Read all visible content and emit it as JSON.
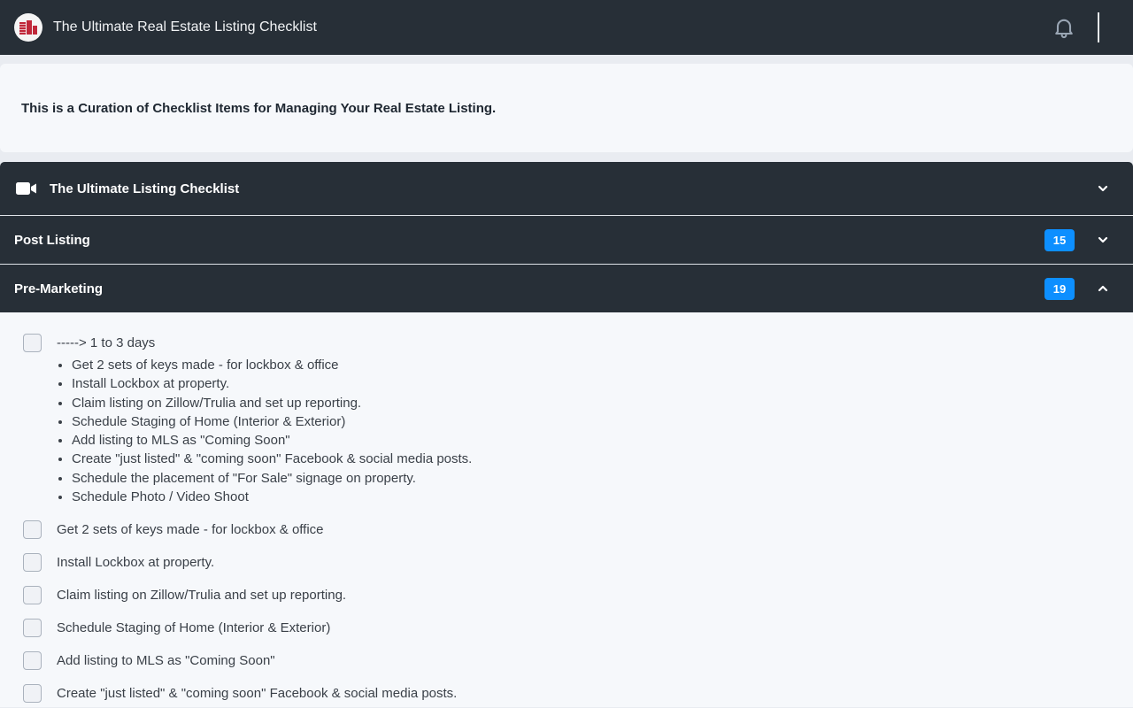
{
  "app": {
    "title": "The Ultimate Real Estate Listing Checklist",
    "logo_icon": "building-logo-icon",
    "notification_icon": "bell-icon"
  },
  "intro": {
    "text": "This is a Curation of Checklist Items for Managing Your Real Estate Listing."
  },
  "sections": [
    {
      "title": "The Ultimate Listing Checklist",
      "icon": "video-camera-icon",
      "badge": null,
      "expanded": false
    },
    {
      "title": "Post Listing",
      "badge": "15",
      "expanded": false
    },
    {
      "title": "Pre-Marketing",
      "badge": "19",
      "expanded": true
    }
  ],
  "premarketing": {
    "grouped_item": {
      "label": "-----> 1 to 3 days",
      "checked": false,
      "subitems": [
        "Get 2 sets of keys made - for lockbox & office",
        "Install Lockbox at property.",
        "Claim listing on Zillow/Trulia and set up reporting.",
        "Schedule Staging of Home (Interior & Exterior)",
        "Add listing to MLS as \"Coming Soon\"",
        "Create \"just listed\" & \"coming soon\" Facebook & social media posts.",
        "Schedule the placement of \"For Sale\" signage on property.",
        "Schedule Photo / Video Shoot"
      ]
    },
    "items": [
      {
        "label": "Get 2 sets of keys made - for lockbox & office",
        "checked": false
      },
      {
        "label": "Install Lockbox at property.",
        "checked": false
      },
      {
        "label": "Claim listing on Zillow/Trulia and set up reporting.",
        "checked": false
      },
      {
        "label": "Schedule Staging of Home (Interior & Exterior)",
        "checked": false
      },
      {
        "label": "Add listing to MLS as \"Coming Soon\"",
        "checked": false
      },
      {
        "label": "Create \"just listed\" & \"coming soon\" Facebook & social media posts.",
        "checked": false
      }
    ]
  },
  "colors": {
    "header_bg": "#272f37",
    "badge_bg": "#0d8fff",
    "logo_red": "#c0283a",
    "content_bg": "#f6f8fb"
  }
}
